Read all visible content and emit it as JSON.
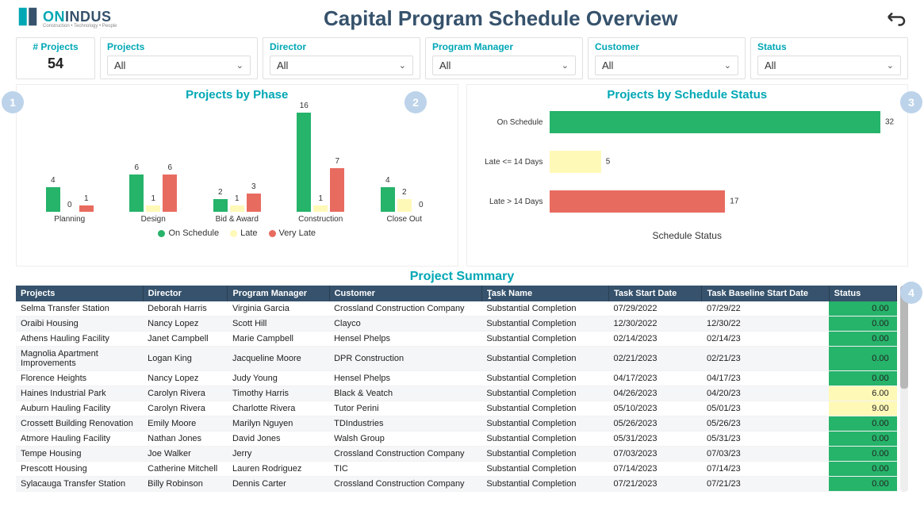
{
  "header": {
    "title": "Capital Program Schedule Overview",
    "logo": {
      "on": "ON",
      "indus": "INDUS",
      "sub": "Construction • Technology • People"
    }
  },
  "filters": {
    "count_label": "# Projects",
    "count_value": "54",
    "items": [
      {
        "label": "Projects",
        "value": "All"
      },
      {
        "label": "Director",
        "value": "All"
      },
      {
        "label": "Program Manager",
        "value": "All"
      },
      {
        "label": "Customer",
        "value": "All"
      },
      {
        "label": "Status",
        "value": "All"
      }
    ]
  },
  "chart_data": [
    {
      "type": "bar",
      "title": "Projects by Phase",
      "categories": [
        "Planning",
        "Design",
        "Bid & Award",
        "Construction",
        "Close Out"
      ],
      "series": [
        {
          "name": "On Schedule",
          "color": "#26b36a",
          "values": [
            4,
            6,
            2,
            16,
            4
          ]
        },
        {
          "name": "Late",
          "color": "#fff9b8",
          "values": [
            0,
            1,
            1,
            1,
            2
          ]
        },
        {
          "name": "Very Late",
          "color": "#e86b60",
          "values": [
            1,
            6,
            3,
            7,
            0
          ]
        }
      ],
      "ylim": [
        0,
        16
      ]
    },
    {
      "type": "bar",
      "orientation": "horizontal",
      "title": "Projects by Schedule Status",
      "categories": [
        "On Schedule",
        "Late <= 14 Days",
        "Late > 14 Days"
      ],
      "values": [
        32,
        5,
        17
      ],
      "colors": [
        "#26b36a",
        "#fff9b8",
        "#e86b60"
      ],
      "xlabel": "Schedule Status",
      "xlim": [
        0,
        32
      ]
    }
  ],
  "legend": {
    "on": "On Schedule",
    "late": "Late",
    "vlate": "Very Late"
  },
  "table": {
    "title": "Project Summary",
    "columns": [
      "Projects",
      "Director",
      "Program Manager",
      "Customer",
      "Task Name",
      "Task Start Date",
      "Task Baseline Start Date",
      "Status"
    ],
    "rows": [
      {
        "project": "Selma Transfer Station",
        "director": "Deborah Harris",
        "pm": "Virginia Garcia",
        "customer": "Crossland Construction Company",
        "task": "Substantial Completion",
        "start": "07/29/2022",
        "baseline": "07/29/22",
        "status": "0.00",
        "status_class": "st-green"
      },
      {
        "project": "Oraibi Housing",
        "director": "Nancy Lopez",
        "pm": "Scott Hill",
        "customer": "Clayco",
        "task": "Substantial Completion",
        "start": "12/30/2022",
        "baseline": "12/30/22",
        "status": "0.00",
        "status_class": "st-green"
      },
      {
        "project": "Athens Hauling Facility",
        "director": "Janet Campbell",
        "pm": "Marie Campbell",
        "customer": "Hensel Phelps",
        "task": "Substantial Completion",
        "start": "02/14/2023",
        "baseline": "02/14/23",
        "status": "0.00",
        "status_class": "st-green"
      },
      {
        "project": "Magnolia Apartment Improvements",
        "director": "Logan King",
        "pm": "Jacqueline Moore",
        "customer": "DPR Construction",
        "task": "Substantial Completion",
        "start": "02/21/2023",
        "baseline": "02/21/23",
        "status": "0.00",
        "status_class": "st-green"
      },
      {
        "project": "Florence Heights",
        "director": "Nancy Lopez",
        "pm": "Judy Young",
        "customer": "Hensel Phelps",
        "task": "Substantial Completion",
        "start": "04/17/2023",
        "baseline": "04/17/23",
        "status": "0.00",
        "status_class": "st-green"
      },
      {
        "project": "Haines Industrial Park",
        "director": "Carolyn Rivera",
        "pm": "Timothy Harris",
        "customer": "Black & Veatch",
        "task": "Substantial Completion",
        "start": "04/26/2023",
        "baseline": "04/20/23",
        "status": "6.00",
        "status_class": "st-yellow"
      },
      {
        "project": "Auburn Hauling Facility",
        "director": "Carolyn Rivera",
        "pm": "Charlotte Rivera",
        "customer": "Tutor Perini",
        "task": "Substantial Completion",
        "start": "05/10/2023",
        "baseline": "05/01/23",
        "status": "9.00",
        "status_class": "st-yellow"
      },
      {
        "project": "Crossett Building Renovation",
        "director": "Emily Moore",
        "pm": "Marilyn Nguyen",
        "customer": "TDIndustries",
        "task": "Substantial Completion",
        "start": "05/26/2023",
        "baseline": "05/26/23",
        "status": "0.00",
        "status_class": "st-green"
      },
      {
        "project": "Atmore Hauling Facility",
        "director": "Nathan Jones",
        "pm": "David Jones",
        "customer": "Walsh Group",
        "task": "Substantial Completion",
        "start": "05/31/2023",
        "baseline": "05/31/23",
        "status": "0.00",
        "status_class": "st-green"
      },
      {
        "project": "Tempe Housing",
        "director": "Joe Walker",
        "pm": "Jerry",
        "customer": "Crossland Construction Company",
        "task": "Substantial Completion",
        "start": "07/03/2023",
        "baseline": "07/03/23",
        "status": "0.00",
        "status_class": "st-green"
      },
      {
        "project": "Prescott Housing",
        "director": "Catherine Mitchell",
        "pm": "Lauren Rodriguez",
        "customer": "TIC",
        "task": "Substantial Completion",
        "start": "07/14/2023",
        "baseline": "07/14/23",
        "status": "0.00",
        "status_class": "st-green"
      },
      {
        "project": "Sylacauga Transfer Station",
        "director": "Billy Robinson",
        "pm": "Dennis Carter",
        "customer": "Crossland Construction Company",
        "task": "Substantial Completion",
        "start": "07/21/2023",
        "baseline": "07/21/23",
        "status": "0.00",
        "status_class": "st-green"
      }
    ]
  },
  "annotations": {
    "b1": "1",
    "b2": "2",
    "b3": "3",
    "b4": "4"
  }
}
